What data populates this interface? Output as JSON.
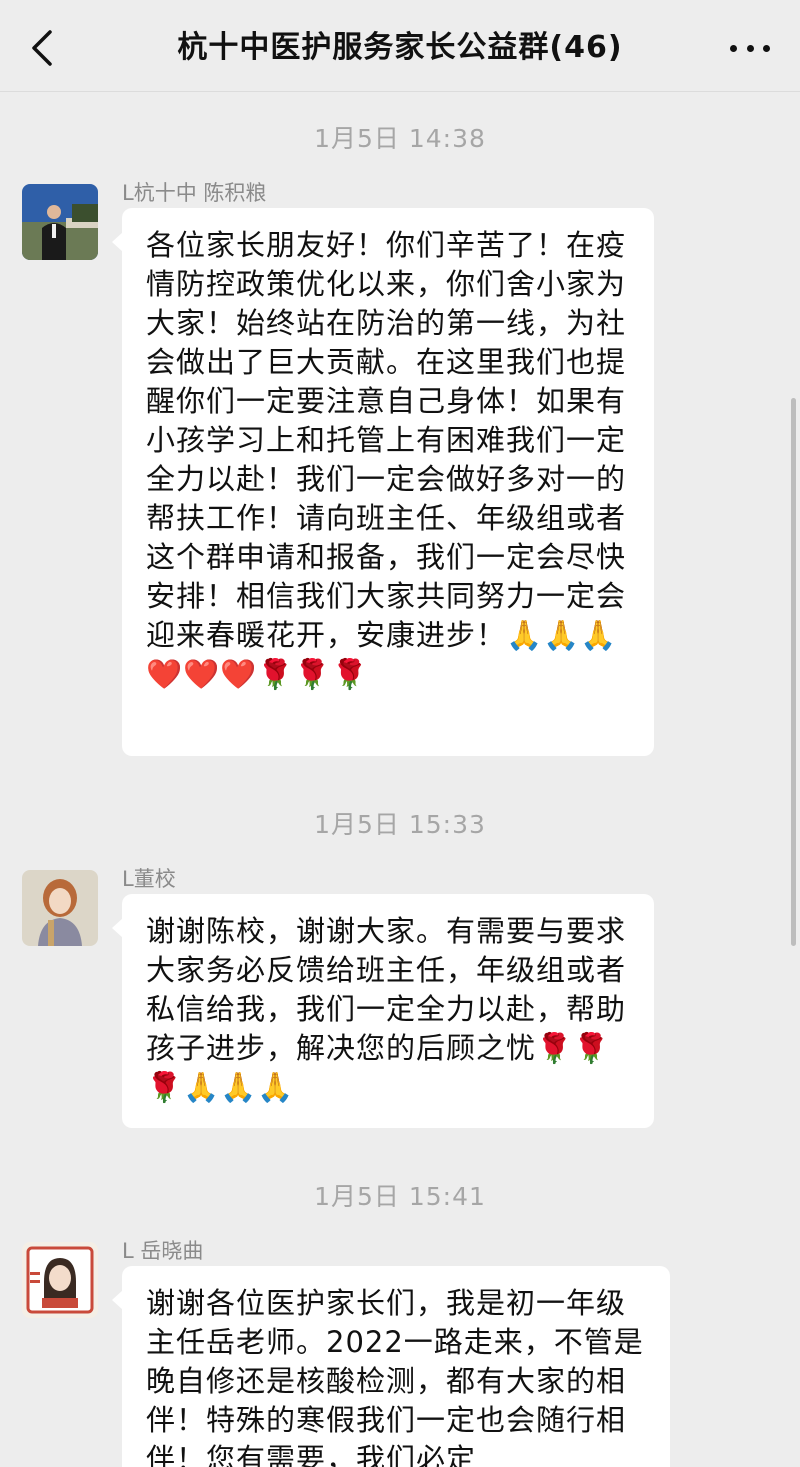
{
  "header": {
    "title": "杭十中医护服务家长公益群(46)"
  },
  "messages": [
    {
      "time": "1月5日 14:38",
      "sender": "L杭十中 陈积粮",
      "text": "各位家长朋友好！你们辛苦了！在疫情防控政策优化以来，你们舍小家为大家！始终站在防治的第一线，为社会做出了巨大贡献。在这里我们也提醒你们一定要注意自己身体！如果有小孩学习上和托管上有困难我们一定全力以赴！我们一定会做好多对一的帮扶工作！请向班主任、年级组或者这个群申请和报备，我们一定会尽快安排！相信我们大家共同努力一定会迎来春暖花开，安康进步！🙏🙏🙏❤️❤️❤️🌹🌹🌹"
    },
    {
      "time": "1月5日 15:33",
      "sender": "L董校",
      "text": "谢谢陈校，谢谢大家。有需要与要求大家务必反馈给班主任，年级组或者私信给我，我们一定全力以赴，帮助孩子进步，解决您的后顾之忧🌹🌹🌹🙏🙏🙏"
    },
    {
      "time": "1月5日 15:41",
      "sender": "L 岳晓曲",
      "text": "谢谢各位医护家长们，我是初一年级主任岳老师。2022一路走来，不管是晚自修还是核酸检测，都有大家的相伴！特殊的寒假我们一定也会随行相伴！您有需要，我们必定"
    }
  ]
}
